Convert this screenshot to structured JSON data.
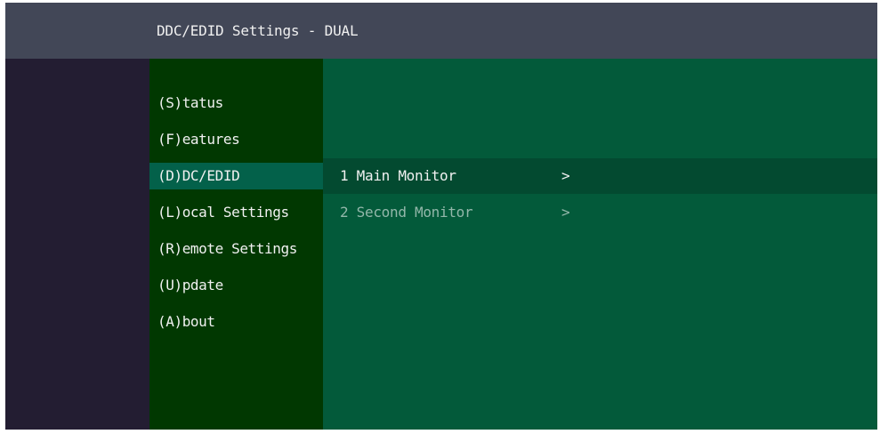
{
  "header": {
    "title": "DDC/EDID Settings - DUAL"
  },
  "menu": {
    "items": [
      {
        "label": "(S)tatus",
        "selected": false
      },
      {
        "label": "(F)eatures",
        "selected": false
      },
      {
        "label": "(D)DC/EDID",
        "selected": true
      },
      {
        "label": "(L)ocal Settings",
        "selected": false
      },
      {
        "label": "(R)emote Settings",
        "selected": false
      },
      {
        "label": "(U)pdate",
        "selected": false
      },
      {
        "label": "(A)bout",
        "selected": false
      }
    ]
  },
  "submenu": {
    "items": [
      {
        "label": "1 Main Monitor",
        "chevron": ">",
        "selected": true
      },
      {
        "label": "2 Second Monitor",
        "chevron": ">",
        "selected": false
      }
    ]
  },
  "colors": {
    "titlebar": "#424757",
    "left_pane": "#231d32",
    "menu_pane": "#013801",
    "menu_selected": "#03614a",
    "content_pane": "#035a3a",
    "submenu_selected": "#034a30",
    "text": "#f1f1f1",
    "text_dim": "#93b7aa"
  }
}
